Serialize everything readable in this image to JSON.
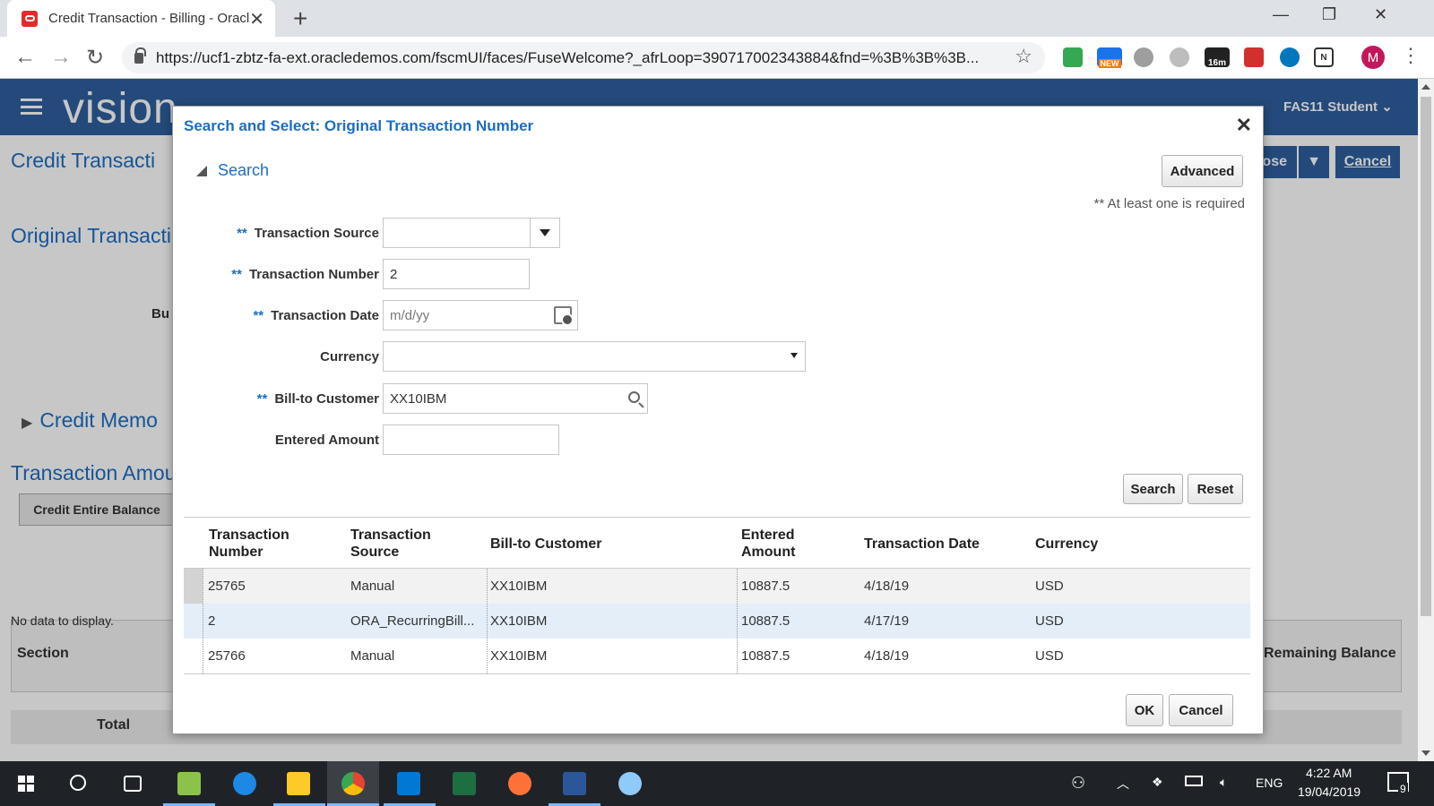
{
  "browser": {
    "tab_title": "Credit Transaction - Billing - Oracle",
    "tab_close": "✕",
    "new_tab": "+",
    "url": "https://ucf1-zbtz-fa-ext.oracledemos.com/fscmUI/faces/FuseWelcome?_afrLoop=390717002343884&fnd=%3B%3B%3B...",
    "back": "←",
    "forward": "→",
    "reload": "↻",
    "star": "☆",
    "menu": "⋮",
    "minimize": "—",
    "restore": "❐",
    "close": "✕",
    "ext_new_badge": "NEW",
    "ext_timer_badge": "16m",
    "profile_initial": "M",
    "colors": {
      "tabstrip": "#dee1e6",
      "profile": "#c2185b"
    }
  },
  "app": {
    "logo": "vision",
    "user_menu": "FAS11 Student",
    "page_title": "Credit Transacti",
    "section_original": "Original Transacti",
    "business_label": "Bu",
    "credit_memo": "Credit Memo",
    "transaction_amount": "Transaction Amou",
    "credit_entire_balance": "Credit Entire Balance",
    "section_header": "Section",
    "remaining_balance_header": "Remaining Balance",
    "no_data": "No data to display.",
    "total": "Total",
    "save_close_btn": "lose",
    "cancel_btn": "Cancel",
    "colors": {
      "header": "#2e5f9e",
      "title": "#1e6dc0"
    }
  },
  "dialog": {
    "title": "Search and Select: Original Transaction Number",
    "close_icon": "✕",
    "search_toggle": "Search",
    "advanced_btn": "Advanced",
    "required_note": "** At least one is required",
    "required_marker": "**",
    "fields": {
      "transaction_source": {
        "label": "Transaction Source",
        "value": ""
      },
      "transaction_number": {
        "label": "Transaction Number",
        "value": "2"
      },
      "transaction_date": {
        "label": "Transaction Date",
        "placeholder": "m/d/yy"
      },
      "currency": {
        "label": "Currency",
        "value": ""
      },
      "bill_to_customer": {
        "label": "Bill-to Customer",
        "value": "XX10IBM"
      },
      "entered_amount": {
        "label": "Entered Amount",
        "value": ""
      }
    },
    "search_btn": "Search",
    "reset_btn": "Reset",
    "table": {
      "headers": {
        "transaction_number": "Transaction Number",
        "transaction_source": "Transaction Source",
        "bill_to_customer": "Bill-to Customer",
        "entered_amount": "Entered Amount",
        "transaction_date": "Transaction Date",
        "currency": "Currency"
      },
      "rows": [
        {
          "number": "25765",
          "source": "Manual",
          "customer": "XX10IBM",
          "amount": "10887.5",
          "date": "4/18/19",
          "currency": "USD"
        },
        {
          "number": "2",
          "source": "ORA_RecurringBill...",
          "customer": "XX10IBM",
          "amount": "10887.5",
          "date": "4/17/19",
          "currency": "USD"
        },
        {
          "number": "25766",
          "source": "Manual",
          "customer": "XX10IBM",
          "amount": "10887.5",
          "date": "4/18/19",
          "currency": "USD"
        }
      ]
    },
    "ok_btn": "OK",
    "cancel_btn": "Cancel",
    "colors": {
      "title": "#1e6dc0",
      "selected_row": "#e3eef9"
    }
  },
  "taskbar": {
    "time": "4:22 AM",
    "date": "19/04/2019",
    "language": "ENG",
    "notification_count": "9",
    "apps": [
      "start",
      "search",
      "task-view",
      "notepad",
      "edge",
      "file-explorer",
      "chrome",
      "outlook",
      "excel",
      "firefox",
      "word",
      "paint"
    ]
  }
}
